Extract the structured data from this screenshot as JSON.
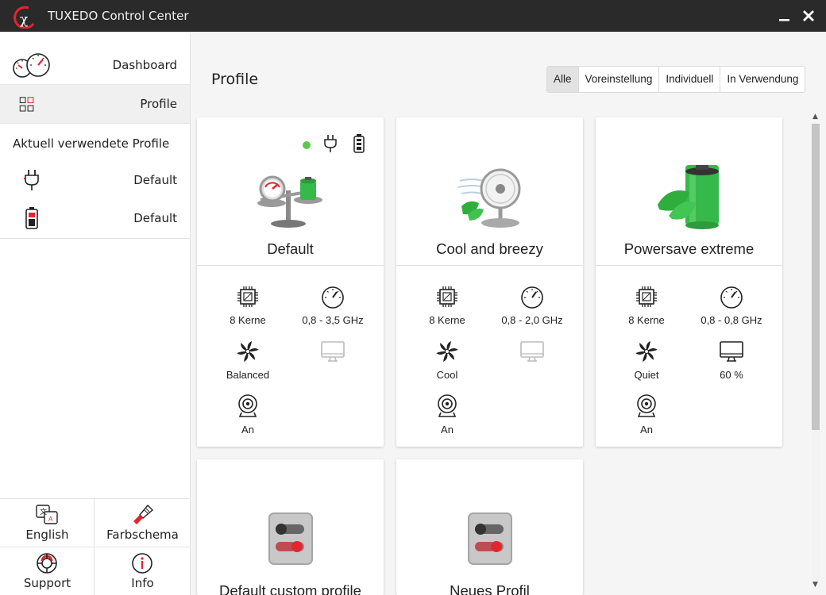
{
  "window": {
    "title": "TUXEDO Control Center"
  },
  "sidebar": {
    "nav": [
      {
        "label": "Dashboard"
      },
      {
        "label": "Profile"
      }
    ],
    "used_heading": "Aktuell verwendete Profile",
    "used": [
      {
        "icon": "plug-icon",
        "value": "Default"
      },
      {
        "icon": "battery-icon",
        "value": "Default"
      }
    ],
    "bottom": [
      {
        "icon": "language-icon",
        "label": "English"
      },
      {
        "icon": "brush-icon",
        "label": "Farbschema"
      },
      {
        "icon": "lifebuoy-icon",
        "label": "Support"
      },
      {
        "icon": "info-icon",
        "label": "Info"
      }
    ]
  },
  "main": {
    "title": "Profile",
    "filters": [
      "Alle",
      "Voreinstellung",
      "Individuell",
      "In Verwendung"
    ],
    "active_filter": "Alle",
    "cards": [
      {
        "name": "Default",
        "active_indicator_color": "#5cc94b",
        "specs": {
          "cores": "8 Kerne",
          "freq": "0,8 - 3,5 GHz",
          "fan": "Balanced",
          "display": "",
          "webcam": "An"
        },
        "display_enabled": false
      },
      {
        "name": "Cool and breezy",
        "specs": {
          "cores": "8 Kerne",
          "freq": "0,8 - 2,0 GHz",
          "fan": "Cool",
          "display": "",
          "webcam": "An"
        },
        "display_enabled": false
      },
      {
        "name": "Powersave extreme",
        "specs": {
          "cores": "8 Kerne",
          "freq": "0,8 - 0,8 GHz",
          "fan": "Quiet",
          "display": "60 %",
          "webcam": "An"
        },
        "display_enabled": true
      },
      {
        "name": "Default custom profile"
      },
      {
        "name": "Neues Profil"
      }
    ]
  },
  "colors": {
    "accent_red": "#e3262e",
    "titlebar": "#2a2a2a",
    "green": "#3cc24a"
  }
}
